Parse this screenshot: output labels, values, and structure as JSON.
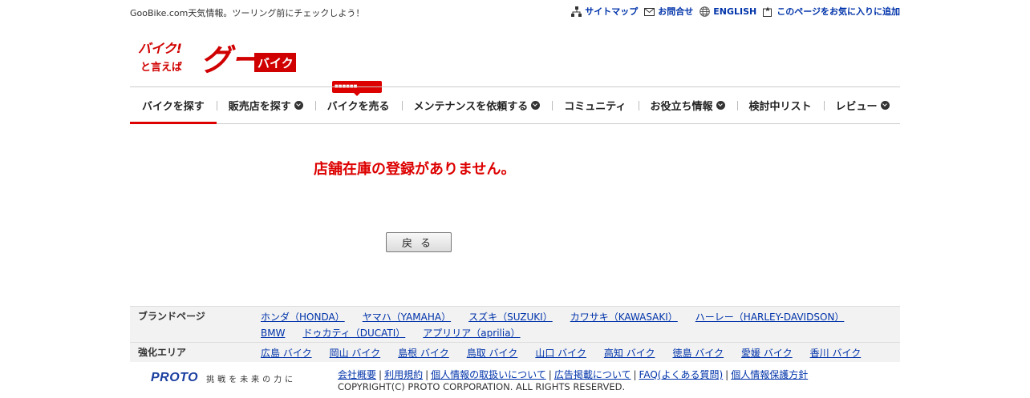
{
  "header": {
    "tagline": "GooBike.com天気情報。ツーリング前にチェックしよう！",
    "links": [
      {
        "label": "サイトマップ",
        "icon": "sitemap-icon"
      },
      {
        "label": "お問合せ",
        "icon": "mail-icon"
      },
      {
        "label": "ENGLISH",
        "icon": "globe-icon"
      },
      {
        "label": "このページをお気に入りに追加",
        "icon": "bookmark-icon"
      }
    ]
  },
  "logo": {
    "line1": "バイク!",
    "line2": "と言えば",
    "brand": "グー",
    "sub": "バイク",
    "color": "#d00000"
  },
  "nav": {
    "items": [
      {
        "label": "バイクを探す",
        "dropdown": false,
        "active": true
      },
      {
        "label": "販売店を探す",
        "dropdown": true
      },
      {
        "label": "バイクを売る",
        "dropdown": false
      },
      {
        "label": "メンテナンスを依頼する",
        "dropdown": true
      },
      {
        "label": "コミュニティ",
        "dropdown": false
      },
      {
        "label": "お役立ち情報",
        "dropdown": true
      },
      {
        "label": "検討中リスト",
        "dropdown": false
      },
      {
        "label": "レビュー",
        "dropdown": true
      }
    ],
    "badge": "■■■■■■"
  },
  "main": {
    "message": "店舗在庫の登録がありません。",
    "back_button": "戻る"
  },
  "brand_links": {
    "brand_label": "ブランドページ",
    "brands": [
      "ホンダ（HONDA）",
      "ヤマハ（YAMAHA）",
      "スズキ（SUZUKI）",
      "カワサキ（KAWASAKI）",
      "ハーレー（HARLEY-DAVIDSON）",
      "BMW",
      "ドゥカティ（DUCATI）",
      "アプリリア（aprilia）"
    ],
    "area_label": "強化エリア",
    "areas": [
      "広島 バイク",
      "岡山 バイク",
      "島根 バイク",
      "鳥取 バイク",
      "山口 バイク",
      "高知 バイク",
      "徳島 バイク",
      "愛媛 バイク",
      "香川 バイク"
    ]
  },
  "footer": {
    "logo": "PROTO",
    "slogan": "挑戦を未来の力に",
    "links": [
      "会社概要",
      "利用規約",
      "個人情報の取扱いについて",
      "広告掲載について",
      "FAQ(よくある質問)",
      "個人情報保護方針"
    ],
    "copyright": "COPYRIGHT(C) PROTO CORPORATION. ALL RIGHTS RESERVED."
  },
  "colors": {
    "accent": "#d00000",
    "link": "#0033aa",
    "brand_blue": "#1a3fa0"
  }
}
